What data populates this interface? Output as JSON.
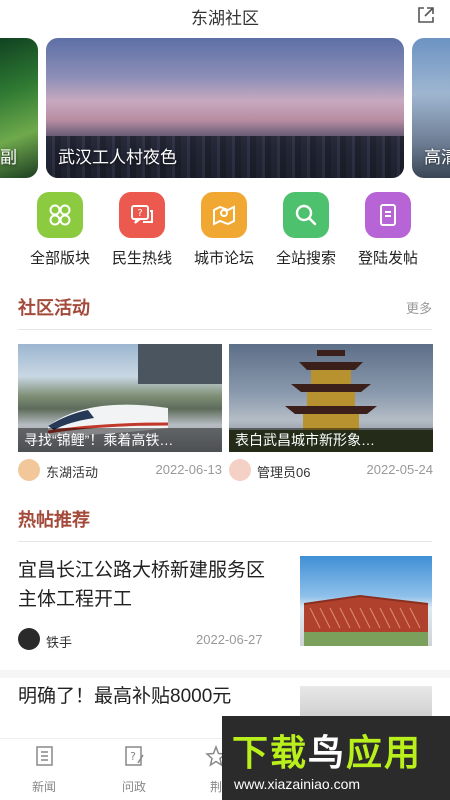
{
  "header": {
    "title": "东湖社区",
    "share_icon": "share-icon"
  },
  "banner": {
    "slides": [
      {
        "caption": "副"
      },
      {
        "caption": "武汉工人村夜色"
      },
      {
        "caption": "高清"
      }
    ]
  },
  "categories": [
    {
      "label": "全部版块",
      "icon": "grid-icon",
      "color": "#8ccb3f"
    },
    {
      "label": "民生热线",
      "icon": "chat-question-icon",
      "color": "#ec5a4f"
    },
    {
      "label": "城市论坛",
      "icon": "map-icon",
      "color": "#f1a832"
    },
    {
      "label": "全站搜索",
      "icon": "search-icon",
      "color": "#4ec16e"
    },
    {
      "label": "登陆发帖",
      "icon": "document-icon",
      "color": "#b764d6"
    }
  ],
  "activities": {
    "title": "社区活动",
    "more": "更多",
    "items": [
      {
        "caption": "寻找“锦鲤”！乘着高铁…",
        "author": "东湖活动",
        "date": "2022-06-13"
      },
      {
        "caption": "表白武昌城市新形象…",
        "author": "管理员06",
        "date": "2022-05-24"
      }
    ]
  },
  "hot": {
    "title": "热帖推荐",
    "posts": [
      {
        "title": "宜昌长江公路大桥新建服务区主体工程开工",
        "author": "铁手",
        "date": "2022-06-27"
      },
      {
        "title": "明确了！最高补贴8000元"
      }
    ]
  },
  "tabbar": [
    {
      "label": "新闻",
      "icon": "news-icon"
    },
    {
      "label": "问政",
      "icon": "question-edit-icon"
    },
    {
      "label": "荆",
      "icon": "star-icon"
    }
  ],
  "watermark": {
    "brand_part1": "下载",
    "brand_part2": "鸟",
    "brand_part3": "应用",
    "url": "www.xiazainiao.com"
  }
}
